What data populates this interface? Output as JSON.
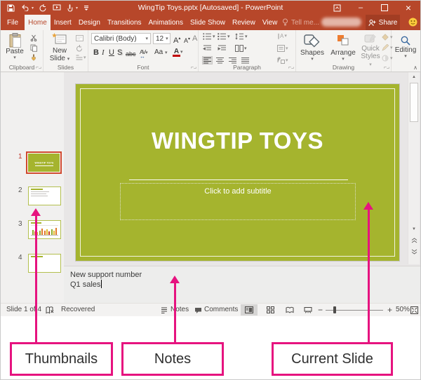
{
  "titlebar": {
    "title": "WingTip Toys.pptx [Autosaved] - PowerPoint"
  },
  "tabs": {
    "file": "File",
    "items": [
      "Home",
      "Insert",
      "Design",
      "Transitions",
      "Animations",
      "Slide Show",
      "Review",
      "View"
    ],
    "active": "Home",
    "tell_me": "Tell me...",
    "share": "Share"
  },
  "ribbon": {
    "clipboard": {
      "label": "Clipboard",
      "paste": "Paste"
    },
    "slides": {
      "label": "Slides",
      "new_line1": "New",
      "new_line2": "Slide"
    },
    "font": {
      "label": "Font",
      "name": "Calibri (Body)",
      "size": "12",
      "bold": "B",
      "italic": "I",
      "underline": "U",
      "shadow": "S",
      "strike": "abc",
      "spacing": "AV",
      "case": "Aa",
      "color": "A",
      "grow": "A",
      "shrink": "A"
    },
    "paragraph": {
      "label": "Paragraph"
    },
    "drawing": {
      "label": "Drawing",
      "shapes": "Shapes",
      "arrange": "Arrange",
      "quick_line1": "Quick",
      "quick_line2": "Styles"
    },
    "editing": {
      "label": "Editing"
    }
  },
  "thumbnails": {
    "items": [
      {
        "number": "1",
        "title": "WINGTIP TOYS",
        "selected": true
      },
      {
        "number": "2"
      },
      {
        "number": "3"
      },
      {
        "number": "4"
      }
    ]
  },
  "slide": {
    "title": "WINGTIP TOYS",
    "subtitle_placeholder": "Click to add subtitle"
  },
  "notes": {
    "line1": "New support number",
    "line2": "Q1 sales"
  },
  "statusbar": {
    "slide_indicator": "Slide 1 of 4",
    "recovered": "Recovered",
    "notes_label": "Notes",
    "comments_label": "Comments",
    "zoom_minus": "−",
    "zoom_plus": "+",
    "zoom_level": "50%"
  },
  "annotations": {
    "thumbnails": "Thumbnails",
    "notes": "Notes",
    "current_slide": "Current Slide"
  },
  "icons": {
    "dropdown": "▾",
    "grow_caret": "▴",
    "shrink_caret": "▾",
    "spacing_arrows": "↔",
    "text_direction": "∥A",
    "minimize": "–",
    "close": "×",
    "scroll_up": "▲",
    "scroll_down": "▼",
    "collapse_ribbon": "∧"
  },
  "colors": {
    "titlebar_red": "#b7472a",
    "share_button": "#a23d23",
    "slide_green": "#a5b42e",
    "selected_thumbnail_border": "#d0492e",
    "annotation_pink": "#e6137f",
    "font_color_red": "#c00000",
    "smiley_yellow": "#fcca3d"
  }
}
